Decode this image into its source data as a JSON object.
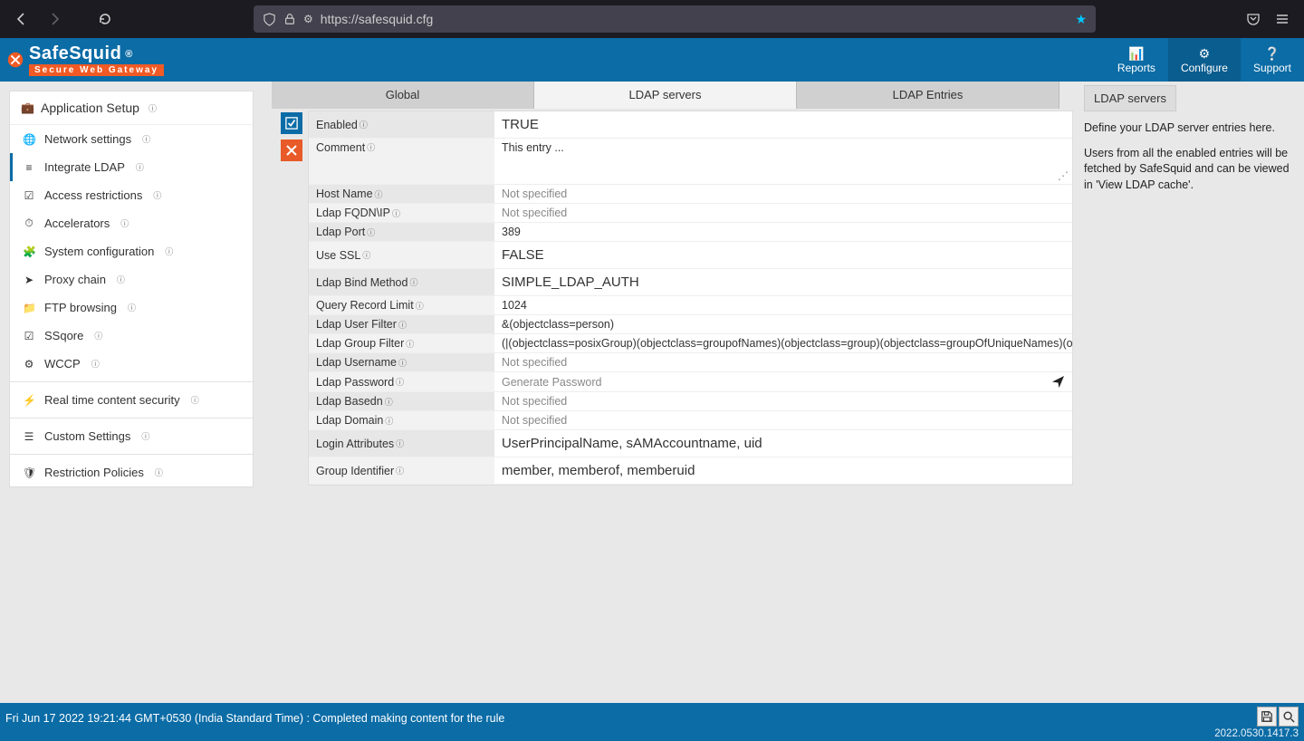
{
  "browser": {
    "url": "https://safesquid.cfg"
  },
  "logo": {
    "name": "SafeSquid",
    "reg": "®",
    "tagline": "Secure Web Gateway"
  },
  "header_nav": {
    "reports": "Reports",
    "configure": "Configure",
    "support": "Support"
  },
  "sidebar": {
    "title": "Application Setup",
    "items": [
      "Network settings",
      "Integrate LDAP",
      "Access restrictions",
      "Accelerators",
      "System configuration",
      "Proxy chain",
      "FTP browsing",
      "SSqore",
      "WCCP"
    ],
    "extra1": "Real time content security",
    "extra2": "Custom Settings",
    "extra3": "Restriction Policies"
  },
  "tabs": {
    "global": "Global",
    "servers": "LDAP servers",
    "entries": "LDAP Entries"
  },
  "form": {
    "enabled_label": "Enabled",
    "enabled_value": "TRUE",
    "comment_label": "Comment",
    "comment_value": "This entry ...",
    "hostname_label": "Host Name",
    "hostname_value": "Not specified",
    "fqdn_label": "Ldap FQDN\\IP",
    "fqdn_value": "Not specified",
    "port_label": "Ldap Port",
    "port_value": "389",
    "ssl_label": "Use SSL",
    "ssl_value": "FALSE",
    "bind_label": "Ldap Bind Method",
    "bind_value": "SIMPLE_LDAP_AUTH",
    "qlimit_label": "Query Record Limit",
    "qlimit_value": "1024",
    "ufilter_label": "Ldap User Filter",
    "ufilter_value": "&(objectclass=person)",
    "gfilter_label": "Ldap Group Filter",
    "gfilter_value": "(|(objectclass=posixGroup)(objectclass=groupofNames)(objectclass=group)(objectclass=groupOfUniqueNames)(objectclass",
    "uname_label": "Ldap Username",
    "uname_value": "Not specified",
    "pwd_label": "Ldap Password",
    "pwd_value": "Generate Password",
    "basedn_label": "Ldap Basedn",
    "basedn_value": "Not specified",
    "domain_label": "Ldap Domain",
    "domain_value": "Not specified",
    "login_label": "Login Attributes",
    "login_value": "UserPrincipalName,   sAMAccountname,   uid",
    "gid_label": "Group Identifier",
    "gid_value": "member,   memberof,   memberuid"
  },
  "help": {
    "title": "LDAP servers",
    "p1": "Define your LDAP server entries here.",
    "p2": "Users from all the enabled entries will be fetched by SafeSquid and can be viewed in 'View LDAP cache'."
  },
  "footer": {
    "status": "Fri Jun 17 2022 19:21:44 GMT+0530 (India Standard Time) : Completed making content for the rule",
    "version": "2022.0530.1417.3"
  }
}
